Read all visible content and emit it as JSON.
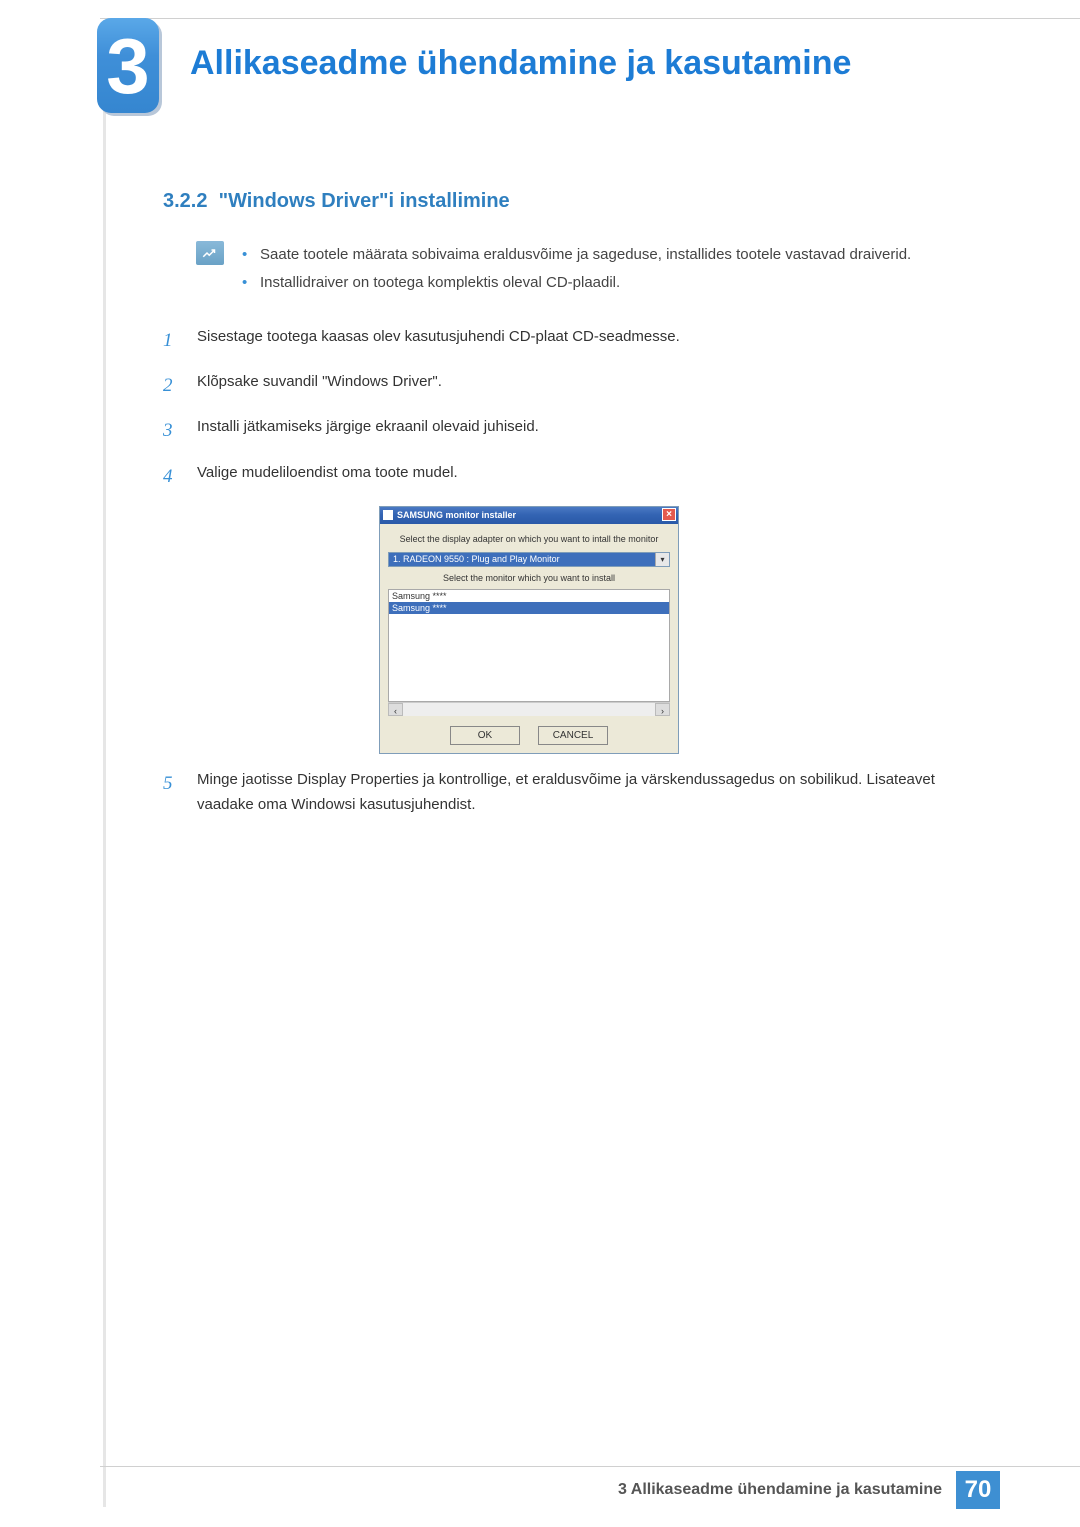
{
  "chapter": {
    "number": "3",
    "title": "Allikaseadme ühendamine ja kasutamine"
  },
  "section": {
    "number": "3.2.2",
    "title": "\"Windows Driver\"i installimine"
  },
  "notes": [
    "Saate tootele määrata sobivaima eraldusvõime ja sageduse, installides tootele vastavad draiverid.",
    "Installidraiver on tootega komplektis oleval CD-plaadil."
  ],
  "steps": [
    {
      "n": "1",
      "text": "Sisestage tootega kaasas olev kasutusjuhendi CD-plaat CD-seadmesse."
    },
    {
      "n": "2",
      "text": "Klõpsake suvandil \"Windows Driver\"."
    },
    {
      "n": "3",
      "text": "Installi jätkamiseks järgige ekraanil olevaid juhiseid."
    },
    {
      "n": "4",
      "text": "Valige mudeliloendist oma toote mudel."
    },
    {
      "n": "5",
      "text": "Minge jaotisse Display Properties ja kontrollige, et eraldusvõime ja värskendussagedus on sobilikud. Lisateavet vaadake oma Windowsi kasutusjuhendist."
    }
  ],
  "dialog": {
    "title": "SAMSUNG monitor installer",
    "close_label": "×",
    "instruction1": "Select the display adapter on which you want to intall the monitor",
    "adapter": "1. RADEON 9550 : Plug and Play Monitor",
    "instruction2": "Select the monitor which you want to install",
    "monitors": [
      "Samsung ****",
      "Samsung ****"
    ],
    "scroll_left": "‹",
    "scroll_right": "›",
    "ok_label": "OK",
    "cancel_label": "CANCEL"
  },
  "footer": {
    "text": "3 Allikaseadme ühendamine ja kasutamine",
    "page": "70"
  }
}
